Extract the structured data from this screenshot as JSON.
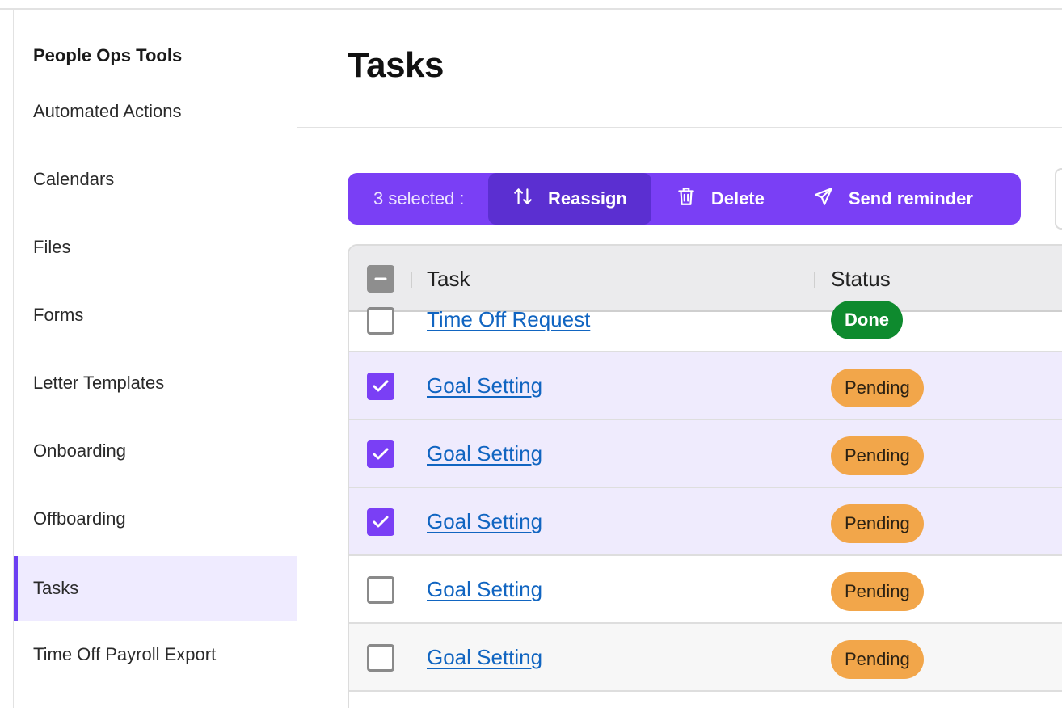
{
  "sidebar": {
    "heading": "People Ops Tools",
    "items": [
      {
        "label": "Automated Actions"
      },
      {
        "label": "Calendars"
      },
      {
        "label": "Files"
      },
      {
        "label": "Forms"
      },
      {
        "label": "Letter Templates"
      },
      {
        "label": "Onboarding"
      },
      {
        "label": "Offboarding"
      },
      {
        "label": "Tasks",
        "active": true
      },
      {
        "label": "Time Off Payroll Export"
      }
    ]
  },
  "header": {
    "title": "Tasks"
  },
  "bulk_actions": {
    "selected_count": "3 selected :",
    "reassign_label": "Reassign",
    "delete_label": "Delete",
    "send_reminder_label": "Send reminder"
  },
  "table": {
    "columns": {
      "task": "Task",
      "status": "Status"
    },
    "rows": [
      {
        "task": "Time Off Request",
        "status": "Done",
        "checked": false
      },
      {
        "task": "Goal Setting",
        "status": "Pending",
        "checked": true
      },
      {
        "task": "Goal Setting",
        "status": "Pending",
        "checked": true
      },
      {
        "task": "Goal Setting",
        "status": "Pending",
        "checked": true
      },
      {
        "task": "Goal Setting",
        "status": "Pending",
        "checked": false
      },
      {
        "task": "Goal Setting",
        "status": "Pending",
        "checked": false
      }
    ]
  },
  "colors": {
    "accent": "#7a3ff5",
    "accent_dark": "#5b2fd1",
    "link": "#1165c1",
    "pending": "#f2a64a",
    "done": "#0e8a2e",
    "selected_row": "#efebfd"
  },
  "icons": {
    "reassign": "arrows-up-down-icon",
    "delete": "trash-icon",
    "send_reminder": "paper-plane-icon",
    "checked": "checkmark-icon",
    "indeterminate": "minus-icon"
  }
}
